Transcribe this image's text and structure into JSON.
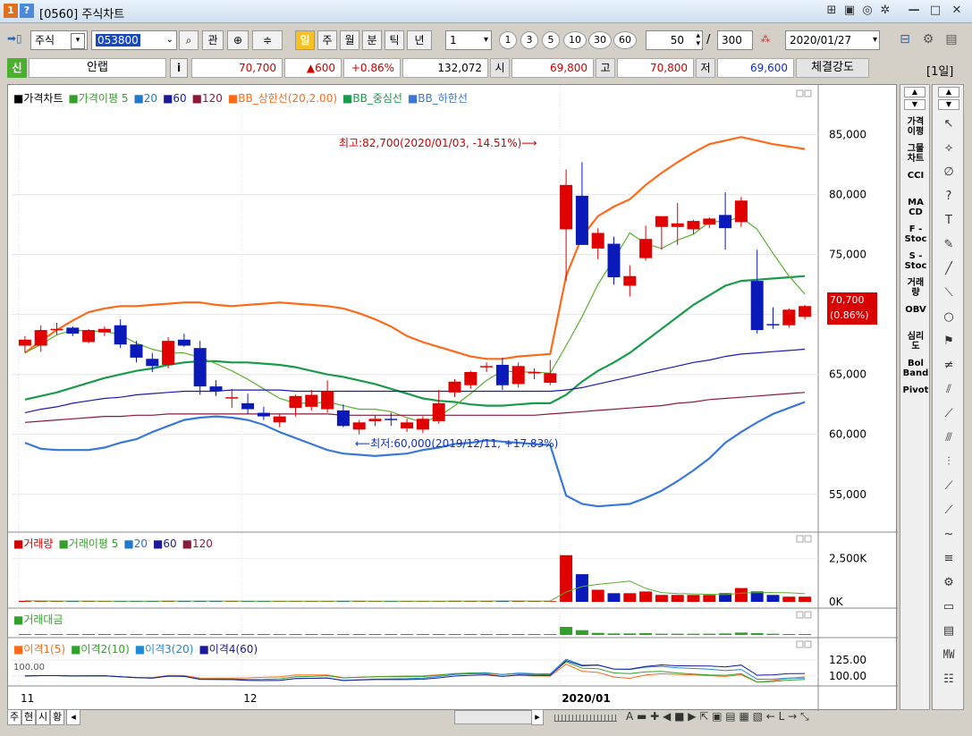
{
  "window": {
    "badge_num": "1",
    "badge_help": "?",
    "title": "[0560] 주식차트",
    "controls": [
      "⊞",
      "▣",
      "◎",
      "✲",
      "—",
      "□",
      "✕"
    ]
  },
  "toolbar": {
    "arrow": "➡▯",
    "market_select": "주식",
    "code_input": "053800",
    "search_icon": "⌕",
    "btn_gwan": "관",
    "icon_a": "⊕",
    "icon_b": "≑",
    "icon_c": "◂",
    "period_il": "일",
    "period_ju": "주",
    "period_wol": "월",
    "period_bun": "분",
    "period_tik": "틱",
    "period_nyeon": "년",
    "interval_select": "1",
    "quick_intervals": [
      "1",
      "3",
      "5",
      "10",
      "30",
      "60"
    ],
    "count_input": "50",
    "slash": "/",
    "total_input": "300",
    "date_select": "2020/01/27"
  },
  "quote": {
    "market_badge": "신",
    "name": "안랩",
    "info_btn": "i",
    "price": "70,700",
    "change": "▲600",
    "change_pct": "+0.86%",
    "volume": "132,072",
    "open_label": "시",
    "open": "69,800",
    "high_label": "고",
    "high": "70,800",
    "low_label": "저",
    "low": "69,600",
    "strength_label": "체결강도",
    "period_badge": "[1일]"
  },
  "legends": {
    "price": [
      {
        "text": "■가격차트",
        "color": "#000000"
      },
      {
        "text": "■가격이평 5",
        "color": "#33a02c"
      },
      {
        "text": "■20",
        "color": "#1f78c8"
      },
      {
        "text": "■60",
        "color": "#1a1a9a"
      },
      {
        "text": "■120",
        "color": "#8b1a3a"
      },
      {
        "text": "■BB_상한선(20,2.00)",
        "color": "#ff6a1a"
      },
      {
        "text": "■BB_중심선",
        "color": "#1a9a4a"
      },
      {
        "text": "■BB_하한선",
        "color": "#3a78d8"
      }
    ],
    "volume": [
      {
        "text": "■거래량",
        "color": "#d00000"
      },
      {
        "text": "■거래이평 5",
        "color": "#33a02c"
      },
      {
        "text": "■20",
        "color": "#1f78c8"
      },
      {
        "text": "■60",
        "color": "#1a1a9a"
      },
      {
        "text": "■120",
        "color": "#8b1a3a"
      }
    ],
    "amount": [
      {
        "text": "■거래대금",
        "color": "#33a02c"
      }
    ],
    "ratio": [
      {
        "text": "■이격1(5)",
        "color": "#ff6a1a"
      },
      {
        "text": "■이격2(10)",
        "color": "#33a02c"
      },
      {
        "text": "■이격3(20)",
        "color": "#1f8ad8"
      },
      {
        "text": "■이격4(60)",
        "color": "#1a1a9a"
      }
    ]
  },
  "chart_data": {
    "type": "candlestick",
    "y_axis_price": [
      "85,000",
      "80,000",
      "75,000",
      "70,000",
      "65,000",
      "60,000",
      "55,000"
    ],
    "y_axis_volume": [
      "2,500K",
      "0K"
    ],
    "y_axis_ratio": [
      "125.00",
      "100.00"
    ],
    "ratio_left_label": "100.00",
    "x_axis_labels": [
      "11",
      "12",
      "2020/01"
    ],
    "current_price_label": [
      "70,700",
      "(0.86%)"
    ],
    "annotation_high": "최고:82,700(2020/01/03, -14.51%)⟶",
    "annotation_low": "⟵최저:60,000(2019/12/11, +17.83%)",
    "candles": [
      {
        "o": 67400,
        "h": 68200,
        "l": 66800,
        "c": 67900
      },
      {
        "o": 67400,
        "h": 69100,
        "l": 66900,
        "c": 68700
      },
      {
        "o": 68700,
        "h": 69300,
        "l": 68300,
        "c": 68800
      },
      {
        "o": 68900,
        "h": 69000,
        "l": 68200,
        "c": 68400
      },
      {
        "o": 67700,
        "h": 68800,
        "l": 67600,
        "c": 68700
      },
      {
        "o": 68500,
        "h": 69000,
        "l": 68200,
        "c": 68800
      },
      {
        "o": 69100,
        "h": 69600,
        "l": 67200,
        "c": 67500
      },
      {
        "o": 67500,
        "h": 67800,
        "l": 66000,
        "c": 66400
      },
      {
        "o": 66300,
        "h": 66800,
        "l": 65200,
        "c": 65700
      },
      {
        "o": 65800,
        "h": 68100,
        "l": 65500,
        "c": 67800
      },
      {
        "o": 67900,
        "h": 68400,
        "l": 67300,
        "c": 67400
      },
      {
        "o": 67200,
        "h": 67800,
        "l": 63300,
        "c": 64000
      },
      {
        "o": 64000,
        "h": 64500,
        "l": 63200,
        "c": 63600
      },
      {
        "o": 63100,
        "h": 63800,
        "l": 62200,
        "c": 63100
      },
      {
        "o": 62600,
        "h": 63400,
        "l": 61700,
        "c": 62100
      },
      {
        "o": 61800,
        "h": 62300,
        "l": 61200,
        "c": 61500
      },
      {
        "o": 61000,
        "h": 61700,
        "l": 60600,
        "c": 61500
      },
      {
        "o": 62200,
        "h": 63300,
        "l": 61500,
        "c": 63200
      },
      {
        "o": 62300,
        "h": 63700,
        "l": 62000,
        "c": 63300
      },
      {
        "o": 62100,
        "h": 64500,
        "l": 61800,
        "c": 63600
      },
      {
        "o": 62000,
        "h": 62500,
        "l": 60600,
        "c": 60700
      },
      {
        "o": 60400,
        "h": 61200,
        "l": 60000,
        "c": 61000
      },
      {
        "o": 61100,
        "h": 61600,
        "l": 60700,
        "c": 61300
      },
      {
        "o": 61300,
        "h": 61800,
        "l": 60700,
        "c": 61200
      },
      {
        "o": 60500,
        "h": 61300,
        "l": 60200,
        "c": 61000
      },
      {
        "o": 60400,
        "h": 61500,
        "l": 60100,
        "c": 61300
      },
      {
        "o": 61100,
        "h": 63700,
        "l": 60900,
        "c": 62600
      },
      {
        "o": 63500,
        "h": 64600,
        "l": 63100,
        "c": 64400
      },
      {
        "o": 64100,
        "h": 65300,
        "l": 63800,
        "c": 65200
      },
      {
        "o": 65600,
        "h": 66000,
        "l": 65200,
        "c": 65700
      },
      {
        "o": 65800,
        "h": 66400,
        "l": 63700,
        "c": 64100
      },
      {
        "o": 64200,
        "h": 66000,
        "l": 63900,
        "c": 65700
      },
      {
        "o": 65100,
        "h": 65500,
        "l": 64600,
        "c": 65200
      },
      {
        "o": 64300,
        "h": 66200,
        "l": 64100,
        "c": 65100
      },
      {
        "o": 77100,
        "h": 82100,
        "l": 72800,
        "c": 80800
      },
      {
        "o": 79900,
        "h": 82700,
        "l": 75800,
        "c": 75800
      },
      {
        "o": 75500,
        "h": 77200,
        "l": 74600,
        "c": 76800
      },
      {
        "o": 75900,
        "h": 76500,
        "l": 72500,
        "c": 73100
      },
      {
        "o": 72400,
        "h": 74100,
        "l": 71500,
        "c": 73200
      },
      {
        "o": 74700,
        "h": 77400,
        "l": 74500,
        "c": 76300
      },
      {
        "o": 77300,
        "h": 78000,
        "l": 75400,
        "c": 78200
      },
      {
        "o": 77300,
        "h": 79300,
        "l": 75800,
        "c": 77600
      },
      {
        "o": 77100,
        "h": 77900,
        "l": 76700,
        "c": 77800
      },
      {
        "o": 77500,
        "h": 78100,
        "l": 77200,
        "c": 78000
      },
      {
        "o": 78300,
        "h": 80200,
        "l": 75400,
        "c": 77200
      },
      {
        "o": 77700,
        "h": 79800,
        "l": 77300,
        "c": 79500
      },
      {
        "o": 72800,
        "h": 75400,
        "l": 68400,
        "c": 68700
      },
      {
        "o": 69200,
        "h": 70600,
        "l": 68800,
        "c": 69100
      },
      {
        "o": 69100,
        "h": 70500,
        "l": 68900,
        "c": 70400
      },
      {
        "o": 69800,
        "h": 70800,
        "l": 69600,
        "c": 70700
      }
    ],
    "lines": {
      "bb_upper": [
        66800,
        67800,
        68700,
        69500,
        70200,
        70500,
        70700,
        70700,
        70800,
        70900,
        71000,
        71000,
        70800,
        70700,
        70800,
        70900,
        71000,
        70900,
        70800,
        70700,
        70500,
        70100,
        69600,
        69000,
        68200,
        67700,
        67300,
        66900,
        66500,
        66300,
        66300,
        66500,
        66600,
        66700,
        73200,
        76500,
        78200,
        79000,
        79600,
        80800,
        81800,
        82700,
        83500,
        84200,
        84500,
        84800,
        84500,
        84200,
        84000,
        83800
      ],
      "bb_mid": [
        62900,
        63200,
        63500,
        63900,
        64300,
        64700,
        65000,
        65300,
        65500,
        65800,
        66000,
        66100,
        66100,
        66000,
        66000,
        65900,
        65800,
        65600,
        65300,
        65000,
        64800,
        64500,
        64200,
        63800,
        63400,
        63000,
        62800,
        62700,
        62500,
        62400,
        62400,
        62500,
        62600,
        62600,
        63300,
        64400,
        65300,
        66000,
        66800,
        67800,
        68800,
        69800,
        70800,
        71600,
        72400,
        72800,
        72900,
        73000,
        73100,
        73200
      ],
      "bb_lower": [
        59300,
        58800,
        58700,
        58700,
        58700,
        58900,
        59300,
        59600,
        60200,
        60700,
        61200,
        61400,
        61500,
        61400,
        61200,
        60800,
        60200,
        59700,
        59200,
        58700,
        58400,
        58300,
        58200,
        58300,
        58400,
        58700,
        58900,
        59200,
        59300,
        59500,
        59400,
        59300,
        59200,
        59100,
        54900,
        54200,
        54000,
        54100,
        54200,
        54700,
        55300,
        56100,
        57000,
        58000,
        59300,
        60200,
        61000,
        61700,
        62200,
        62700
      ],
      "ma5": [
        66800,
        67500,
        68300,
        68700,
        68600,
        68600,
        68300,
        67600,
        67100,
        66800,
        66800,
        66400,
        65900,
        65300,
        64600,
        63800,
        63000,
        62600,
        62600,
        62700,
        62400,
        62100,
        62100,
        61900,
        61400,
        61000,
        61500,
        62400,
        63400,
        64500,
        65300,
        65200,
        65200,
        65100,
        67400,
        69800,
        72500,
        74600,
        76800,
        75900,
        75500,
        76200,
        76700,
        77700,
        77800,
        78100,
        77100,
        75100,
        73200,
        71700
      ],
      "ma20": [
        61800,
        62100,
        62300,
        62600,
        62800,
        63000,
        63100,
        63300,
        63400,
        63500,
        63600,
        63600,
        63600,
        63700,
        63700,
        63700,
        63700,
        63600,
        63600,
        63600,
        63600,
        63600,
        63600,
        63600,
        63600,
        63600,
        63600,
        63600,
        63600,
        63600,
        63600,
        63600,
        63600,
        63600,
        63700,
        63900,
        64200,
        64500,
        64800,
        65100,
        65400,
        65700,
        66000,
        66200,
        66500,
        66700,
        66800,
        66900,
        67000,
        67100
      ],
      "ma60": [
        61000,
        61100,
        61200,
        61300,
        61400,
        61500,
        61500,
        61600,
        61600,
        61700,
        61700,
        61700,
        61700,
        61700,
        61700,
        61700,
        61700,
        61700,
        61700,
        61700,
        61600,
        61600,
        61600,
        61600,
        61600,
        61600,
        61600,
        61600,
        61600,
        61600,
        61600,
        61600,
        61600,
        61700,
        61800,
        61900,
        62000,
        62100,
        62200,
        62300,
        62400,
        62600,
        62700,
        62900,
        63000,
        63100,
        63200,
        63300,
        63400,
        63500
      ]
    },
    "volume": [
      60,
      40,
      40,
      40,
      40,
      40,
      50,
      40,
      40,
      60,
      40,
      50,
      40,
      40,
      40,
      40,
      40,
      50,
      40,
      40,
      50,
      40,
      40,
      40,
      40,
      40,
      40,
      60,
      50,
      40,
      60,
      40,
      40,
      40,
      2700,
      1600,
      700,
      500,
      500,
      600,
      400,
      400,
      400,
      400,
      500,
      800,
      600,
      400,
      300,
      300
    ]
  },
  "indicator_panel": [
    "가격\n이평",
    "그물\n차트",
    "CCI",
    "MA\nCD",
    "F -\nStoc",
    "S -\nStoc",
    "거래\n량",
    "OBV",
    "심리\n도",
    "Bol\nBand",
    "Pivot"
  ],
  "tool_panel": [
    "↖",
    "⟡",
    "∅",
    "?",
    "T",
    "✎",
    "╱",
    "⟍",
    "○",
    "⚑",
    "≠",
    "⫽",
    "⟋",
    "⫻",
    "⫶",
    "⟋",
    "⟋",
    "~",
    "≡",
    "⚙",
    "▭",
    "▤",
    "㎿",
    "☷"
  ],
  "bottom": {
    "tabs": [
      "주",
      "현",
      "시",
      "황"
    ],
    "arrow_left": "◂",
    "arrow_right": "▸",
    "nav_icons": "A ▬ ✚ ◀ ■ ▶ ⇱ ▣ ▤ ▦ ▧ ← L → ⤡"
  }
}
